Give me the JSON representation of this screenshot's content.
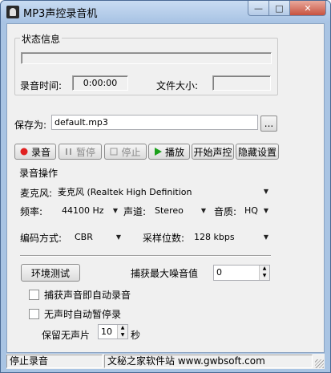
{
  "window": {
    "title": "MP3声控录音机",
    "icons": [
      "microphone-app-icon",
      "minimize-icon",
      "maximize-icon",
      "close-icon"
    ]
  },
  "status_group": {
    "legend": "状态信息",
    "record_time_label": "录音时间:",
    "record_time_value": "0:00:00",
    "file_size_label": "文件大小:",
    "file_size_value": ""
  },
  "save": {
    "label": "保存为:",
    "value": "default.mp3",
    "browse_label": "..."
  },
  "toolbar": {
    "record_label": "录音",
    "pause_label": "暂停",
    "stop_label": "停止",
    "play_label": "播放",
    "voice_control_label": "开始声控",
    "hide_settings_label": "隐藏设置"
  },
  "record_ops": {
    "legend": "录音操作",
    "mic_label": "麦克风:",
    "mic_value": "麦克风 (Realtek High Definition",
    "freq_label": "频率:",
    "freq_value": "44100 Hz",
    "channel_label": "声道:",
    "channel_value": "Stereo",
    "quality_label": "音质:",
    "quality_value": "HQ",
    "encoding_label": "编码方式:",
    "encoding_value": "CBR",
    "bitrate_label": "采样位数:",
    "bitrate_value": "128 kbps",
    "env_test_label": "环境测试",
    "max_noise_label": "捕获最大噪音值",
    "max_noise_value": "0",
    "auto_record_label": "捕获声音即自动录音",
    "auto_pause_label": "无声时自动暂停录",
    "keep_silence_label": "保留无声片",
    "keep_silence_value": "10",
    "seconds_unit": "秒"
  },
  "statusbar": {
    "status": "停止录音",
    "site": "文秘之家软件站 www.gwbsoft.com"
  },
  "colors": {
    "record_red": "#e02020",
    "play_green": "#1aa01a",
    "frame_blue": "#a9c4e3",
    "panel_bg": "#f0f0f0"
  }
}
